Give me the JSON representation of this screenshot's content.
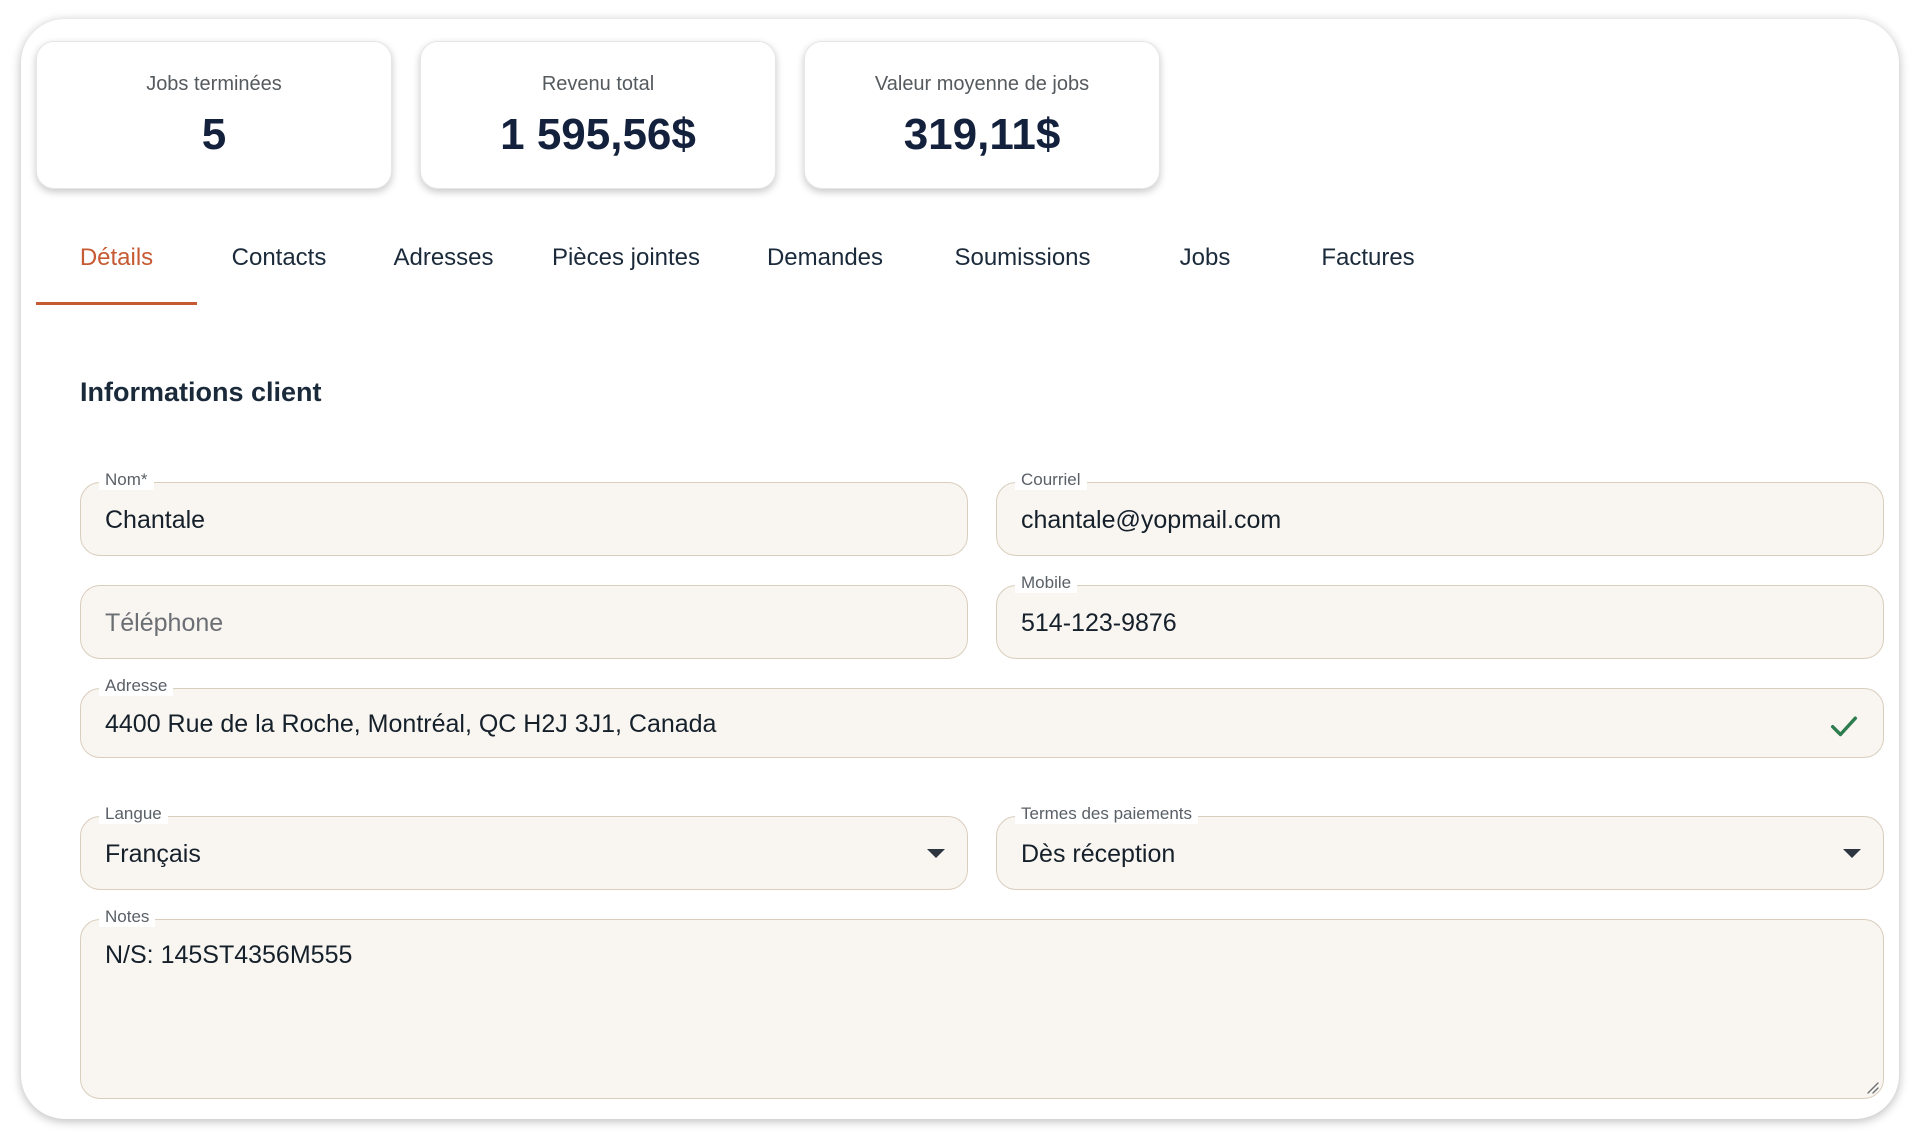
{
  "stats": [
    {
      "label": "Jobs terminées",
      "value": "5"
    },
    {
      "label": "Revenu total",
      "value": "1 595,56$"
    },
    {
      "label": "Valeur moyenne de jobs",
      "value": "319,11$"
    }
  ],
  "tabs": [
    {
      "label": "Détails",
      "active": true
    },
    {
      "label": "Contacts"
    },
    {
      "label": "Adresses"
    },
    {
      "label": "Pièces jointes"
    },
    {
      "label": "Demandes"
    },
    {
      "label": "Soumissions"
    },
    {
      "label": "Jobs"
    },
    {
      "label": "Factures"
    }
  ],
  "section": {
    "title": "Informations client"
  },
  "form": {
    "name": {
      "label": "Nom*",
      "value": "Chantale"
    },
    "email": {
      "label": "Courriel",
      "value": "chantale@yopmail.com"
    },
    "phone": {
      "placeholder": "Téléphone",
      "value": ""
    },
    "mobile": {
      "label": "Mobile",
      "value": "514-123-9876"
    },
    "address": {
      "label": "Adresse",
      "value": "4400 Rue de la Roche, Montréal, QC H2J 3J1, Canada",
      "icon": "check-icon"
    },
    "language": {
      "label": "Langue",
      "value": "Français",
      "icon": "caret-down-icon"
    },
    "payment_terms": {
      "label": "Termes des paiements",
      "value": "Dès réception",
      "icon": "caret-down-icon"
    },
    "notes": {
      "label": "Notes",
      "value": "N/S: 145ST4356M555"
    }
  },
  "colors": {
    "accent": "#c65a32",
    "check": "#2e7d4f",
    "field_bg": "#f9f6f1",
    "field_border": "#d9cdbd",
    "heading": "#14213d"
  }
}
